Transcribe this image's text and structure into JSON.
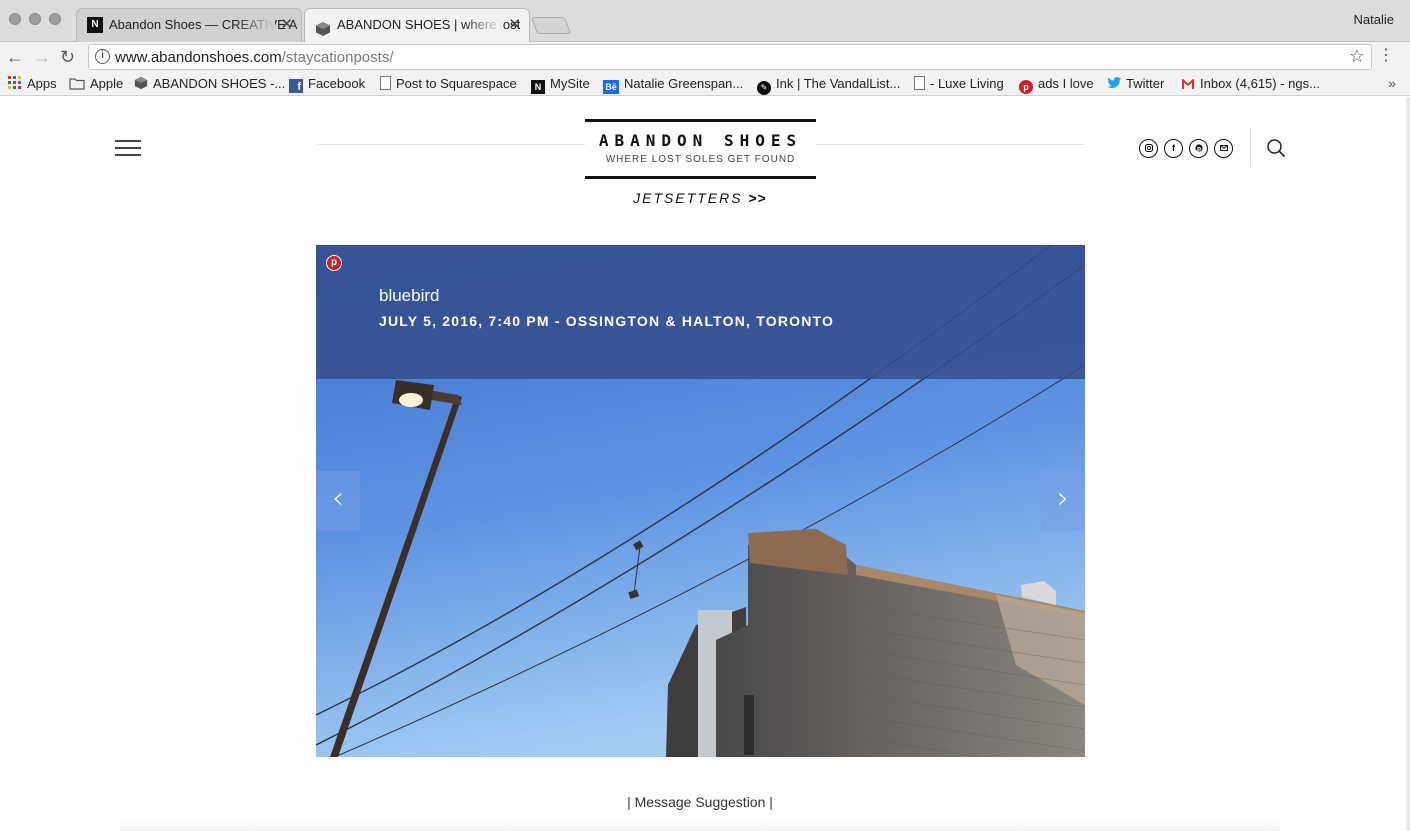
{
  "window": {
    "profile_name": "Natalie",
    "tabs": [
      {
        "label": "Abandon Shoes — CREATIVE A",
        "favicon": "n-logo-icon",
        "active": false
      },
      {
        "label": "ABANDON SHOES | where lost",
        "favicon": "cube-icon",
        "active": true
      }
    ]
  },
  "toolbar": {
    "url_host": "www.abandonshoes.com",
    "url_path": "/staycationposts/"
  },
  "bookmarks": [
    {
      "label": "Apps",
      "icon": "apps-grid-icon"
    },
    {
      "label": "Apple",
      "icon": "folder-icon"
    },
    {
      "label": "ABANDON SHOES -...",
      "icon": "cube-icon"
    },
    {
      "label": "Facebook",
      "icon": "facebook-icon"
    },
    {
      "label": "Post to Squarespace",
      "icon": "page-icon"
    },
    {
      "label": "MySite",
      "icon": "n-logo-icon"
    },
    {
      "label": "Natalie Greenspan...",
      "icon": "behance-icon"
    },
    {
      "label": "Ink | The VandalList...",
      "icon": "ink-icon"
    },
    {
      "label": "- Luxe Living",
      "icon": "page-icon"
    },
    {
      "label": "ads I love",
      "icon": "pinterest-icon"
    },
    {
      "label": "Twitter",
      "icon": "twitter-icon"
    },
    {
      "label": "Inbox (4,615) - ngs...",
      "icon": "gmail-icon"
    }
  ],
  "site": {
    "brand": "ABANDON SHOES",
    "tagline": "WHERE LOST SOLES GET FOUND",
    "nav_link": "JETSETTERS",
    "nav_arrows": ">>",
    "social_icons": [
      "instagram-icon",
      "facebook-icon",
      "pinterest-icon",
      "email-icon"
    ]
  },
  "post": {
    "title": "bluebird",
    "meta": "JULY 5, 2016, 7:40 PM - OSSINGTON & HALTON, TORONTO",
    "footer_link": "| Message Suggestion |"
  },
  "colors": {
    "caption_bg": "#344e8e",
    "sky_top": "#4a7fd6",
    "sky_bottom": "#9cc4f0",
    "pinterest_red": "#cb2027"
  }
}
